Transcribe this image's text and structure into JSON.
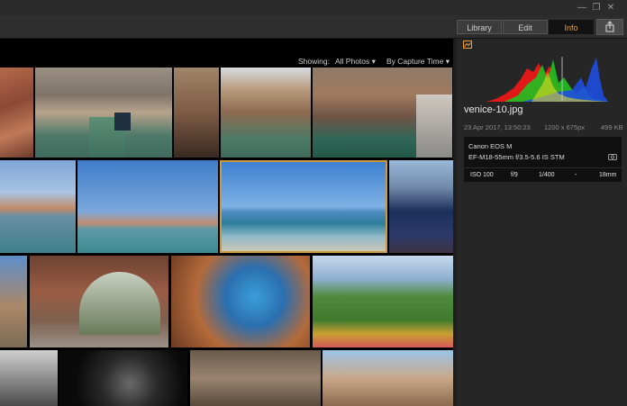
{
  "window": {
    "minimize": "—",
    "restore": "❐",
    "close": "✕"
  },
  "tabs": [
    "Library",
    "Edit",
    "Info"
  ],
  "toolbar": {
    "share_icon": "share-icon"
  },
  "filter": {
    "showing_label": "Showing:",
    "showing_value": "All Photos",
    "sort_value": "By Capture Time"
  },
  "info": {
    "filename": "venice-10.jpg",
    "date": "23 Apr 2017, 13:50:23",
    "dimensions": "1200 x 675px",
    "filesize": "499 KB",
    "camera": "Canon EOS M",
    "lens": "EF-M18-55mm f/3.5-5.6 IS STM",
    "exif": {
      "iso": "ISO 100",
      "aperture": "f/9",
      "shutter": "1/400",
      "exposure": "-",
      "focal": "18mm"
    }
  },
  "colors": {
    "accent": "#f0a030",
    "selection": "#c99a3e"
  }
}
